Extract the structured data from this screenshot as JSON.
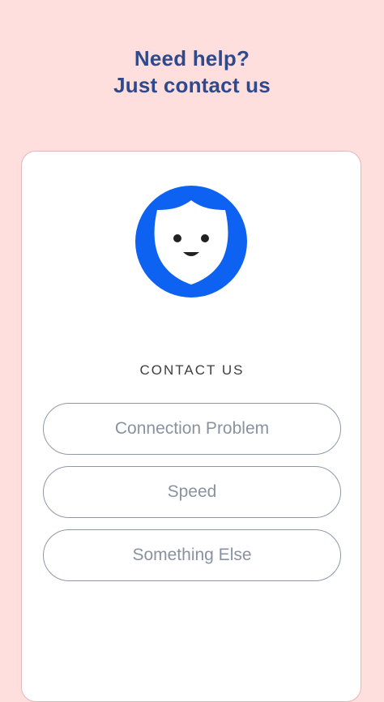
{
  "header": {
    "line1": "Need help?",
    "line2": "Just contact us"
  },
  "card": {
    "logo_icon": "shield-face-icon",
    "section_title": "CONTACT US",
    "options": [
      {
        "label": "Connection Problem"
      },
      {
        "label": "Speed"
      },
      {
        "label": "Something Else"
      }
    ]
  },
  "colors": {
    "background": "#FFDEDE",
    "headline": "#2E4A8C",
    "brand_blue": "#0E62F2",
    "button_border": "#8F98A8",
    "button_text": "#8A929F"
  }
}
